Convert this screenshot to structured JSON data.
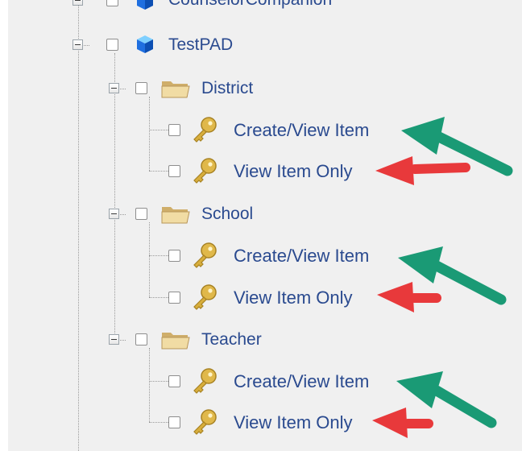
{
  "tree": {
    "items": [
      {
        "label": "CounselorCompanion",
        "level": 0,
        "type": "app",
        "icon": "cube-icon"
      },
      {
        "label": "TestPAD",
        "level": 0,
        "type": "app",
        "icon": "cube-icon"
      },
      {
        "label": "District",
        "level": 1,
        "type": "folder",
        "icon": "folder-icon"
      },
      {
        "label": "Create/View Item",
        "level": 2,
        "type": "permission",
        "icon": "key-icon"
      },
      {
        "label": "View Item Only",
        "level": 2,
        "type": "permission",
        "icon": "key-icon"
      },
      {
        "label": "School",
        "level": 1,
        "type": "folder",
        "icon": "folder-icon"
      },
      {
        "label": "Create/View Item",
        "level": 2,
        "type": "permission",
        "icon": "key-icon"
      },
      {
        "label": "View Item Only",
        "level": 2,
        "type": "permission",
        "icon": "key-icon"
      },
      {
        "label": "Teacher",
        "level": 1,
        "type": "folder",
        "icon": "folder-icon"
      },
      {
        "label": "Create/View Item",
        "level": 2,
        "type": "permission",
        "icon": "key-icon"
      },
      {
        "label": "View Item Only",
        "level": 2,
        "type": "permission",
        "icon": "key-icon"
      }
    ]
  },
  "annotations": {
    "green_arrow_color": "#1a9a75",
    "red_arrow_color": "#e8393b"
  }
}
